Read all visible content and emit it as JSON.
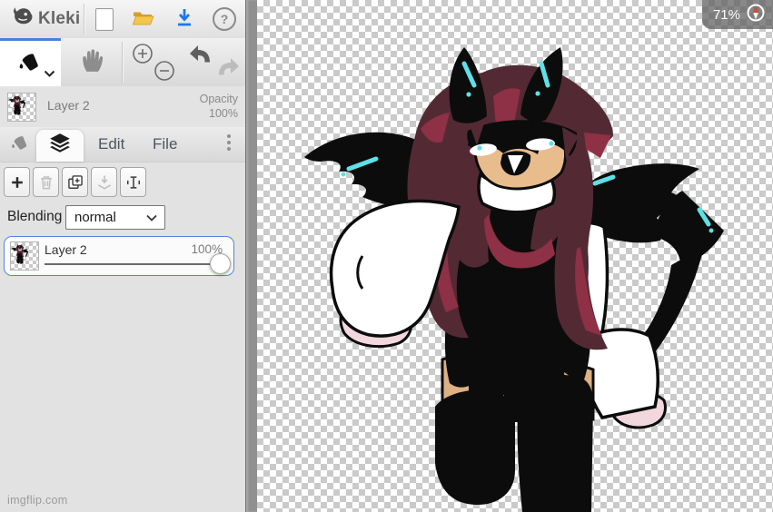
{
  "topbar": {
    "logo_text": "Kleki",
    "help_glyph": "?",
    "icons": [
      "kleki-logo",
      "new-file",
      "open-folder",
      "download",
      "help"
    ]
  },
  "toolbar": {
    "tools": [
      "fill",
      "hand",
      "zoom-in",
      "zoom-out",
      "undo",
      "redo"
    ],
    "selected_tool": "fill"
  },
  "layer_preview": {
    "name": "Layer 2",
    "opacity_label": "Opacity",
    "opacity_value": "100%"
  },
  "tabs": {
    "items": [
      "fill",
      "layers",
      "Edit",
      "File"
    ],
    "selected": "layers",
    "edit_label": "Edit",
    "file_label": "File"
  },
  "layers_panel": {
    "buttons": [
      "add-layer",
      "delete-layer",
      "duplicate-layer",
      "merge-down",
      "rename-layer"
    ],
    "disabled_buttons": [
      "delete-layer",
      "merge-down"
    ],
    "blending_label": "Blending",
    "blending_value": "normal",
    "layer": {
      "name": "Layer 2",
      "opacity": "100%",
      "selected": true
    }
  },
  "canvas": {
    "zoom_badge": "71%",
    "content": "demon character drawing on transparent background"
  },
  "footer": {
    "watermark": "imgflip.com"
  },
  "colors": {
    "accent": "#4e80d6",
    "selection": "#5585d6",
    "checker": "#cacaca",
    "ink": "#0c0c0c",
    "hairdark": "#532a34",
    "hairred": "#8e3046",
    "skin": "#e9bc8e",
    "legskin": "#ddb184",
    "cyan": "#5fdfe6",
    "cuffpink": "#f2d8de",
    "badgebg": "rgba(96,96,96,0.75)"
  }
}
